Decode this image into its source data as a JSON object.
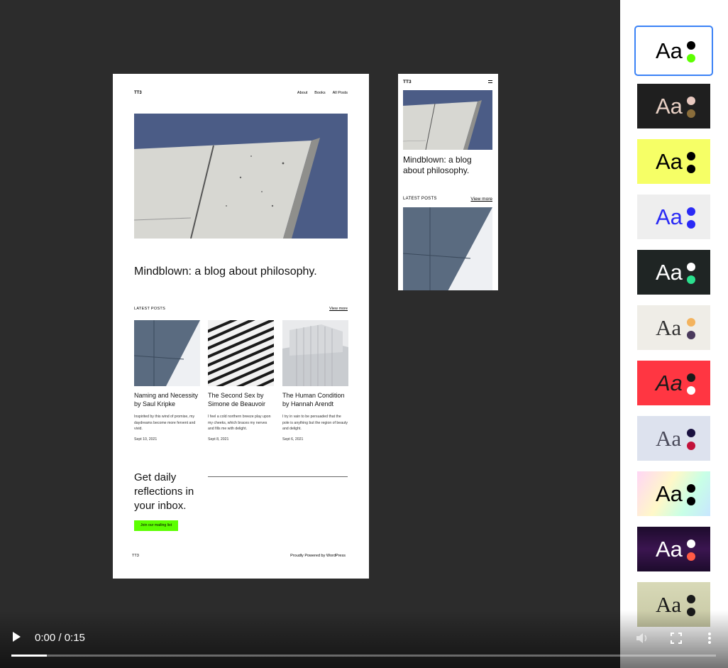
{
  "site": {
    "brand": "TT3",
    "nav": [
      "About",
      "Books",
      "All Posts"
    ],
    "tagline": "Mindblown: a blog about philosophy.",
    "latest_label": "LATEST POSTS",
    "view_more": "View more",
    "posts": [
      {
        "title": "Naming and Necessity by Saul Kripke",
        "excerpt": "Inspirited by this wind of promise, my daydreams become more fervent and vivid.",
        "date": "Sept 10, 2021"
      },
      {
        "title": "The Second Sex by Simone de Beauvoir",
        "excerpt": "I feel a cold northern breeze play upon my cheeks, which braces my nerves and fills me with delight.",
        "date": "Sept 8, 2021"
      },
      {
        "title": "The Human Condition by Hannah Arendt",
        "excerpt": "I try in vain to be persuaded that the pole is anything but the region of beauty and delight.",
        "date": "Sept 6, 2021"
      }
    ],
    "cta_heading": "Get daily reflections in your inbox.",
    "cta_button": "Join our mailing list",
    "footer_brand": "TT3",
    "footer_powered": "Proudly Powered by WordPress"
  },
  "styles": [
    {
      "label": "Aa",
      "bg": "#ffffff",
      "text": "#000000",
      "dot1": "#000000",
      "dot2": "#5cff00",
      "selected": true
    },
    {
      "label": "Aa",
      "bg": "#1f1f1f",
      "text": "#e8d0c4",
      "dot1": "#e8c9c0",
      "dot2": "#8a6d3b"
    },
    {
      "label": "Aa",
      "bg": "#f6ff66",
      "text": "#000000",
      "dot1": "#000000",
      "dot2": "#000000"
    },
    {
      "label": "Aa",
      "bg": "#eeeeee",
      "text": "#2a2af5",
      "dot1": "#2a2af5",
      "dot2": "#2a2af5"
    },
    {
      "label": "Aa",
      "bg": "#1f2524",
      "text": "#ffffff",
      "dot1": "#ffffff",
      "dot2": "#2be08e"
    },
    {
      "label": "Aa",
      "bg": "#efede7",
      "text": "#333333",
      "dot1": "#f3b35e",
      "dot2": "#4a3a5c"
    },
    {
      "label": "Aa",
      "bg": "#ff3642",
      "text": "#1a1a1a",
      "dot1": "#1a1a1a",
      "dot2": "#ffffff"
    },
    {
      "label": "Aa",
      "bg": "#dde2ee",
      "text": "#4a4a5a",
      "dot1": "#1a1140",
      "dot2": "#c2123b"
    },
    {
      "label": "Aa",
      "bg": "#e6f0ff",
      "text": "#000000",
      "dot1": "#000000",
      "dot2": "#000000"
    },
    {
      "label": "Aa",
      "bg": "#2a0f3c",
      "text": "#ffffff",
      "dot1": "#ffffff",
      "dot2": "#ff5a45"
    },
    {
      "label": "Aa",
      "bg": "#d8d9b7",
      "text": "#1a1a1a",
      "dot1": "#1a1a1a",
      "dot2": "#1a1a1a"
    }
  ],
  "video": {
    "time": "0:00 / 0:15",
    "progress": 0.05
  }
}
